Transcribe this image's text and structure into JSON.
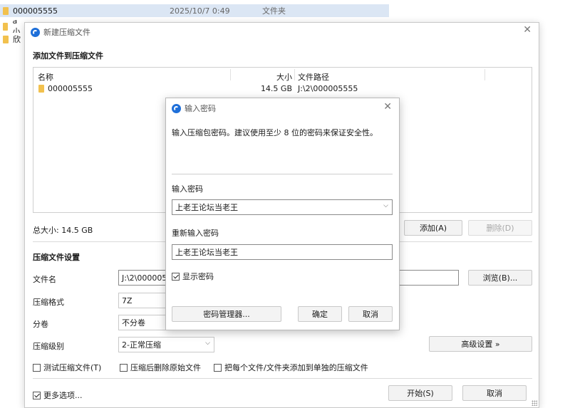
{
  "background": {
    "rows": [
      {
        "name": "000005555",
        "date": "2025/10/7 0:49",
        "type": "文件夹"
      },
      {
        "name": "a小",
        "date": "",
        "type": ""
      },
      {
        "name": "欣",
        "date": "",
        "type": ""
      }
    ]
  },
  "window": {
    "title": "新建压缩文件",
    "section_add": "添加文件到压缩文件",
    "table": {
      "headers": {
        "name": "名称",
        "size": "大小",
        "path": "文件路径"
      },
      "rows": [
        {
          "name": "000005555",
          "size": "14.5 GB",
          "path": "J:\\2\\000005555"
        }
      ]
    },
    "total_size": "总大小: 14.5 GB",
    "add_button": "添加(A)",
    "delete_button": "删除(D)",
    "settings_title": "压缩文件设置",
    "filename_label": "文件名",
    "filename_value": "J:\\2\\000005",
    "browse_button": "浏览(B)...",
    "format_label": "压缩格式",
    "format_value": "7Z",
    "volume_label": "分卷",
    "volume_value": "不分卷",
    "level_label": "压缩级别",
    "level_value": "2-正常压缩",
    "advanced_button": "高级设置 »",
    "opt_test": "测试压缩文件(T)",
    "opt_delete": "压缩后删除原始文件",
    "opt_separate": "把每个文件/文件夹添加到单独的压缩文件",
    "more_options": "更多选项...",
    "start_button": "开始(S)",
    "cancel_button": "取消"
  },
  "dialog": {
    "title": "输入密码",
    "description": "输入压缩包密码。建议使用至少 8 位的密码来保证安全性。",
    "enter_label": "输入密码",
    "enter_value": "上老王论坛当老王",
    "reenter_label": "重新输入密码",
    "reenter_value": "上老王论坛当老王",
    "show_password": "显示密码",
    "manager_button": "密码管理器...",
    "ok_button": "确定",
    "cancel_button": "取消"
  }
}
